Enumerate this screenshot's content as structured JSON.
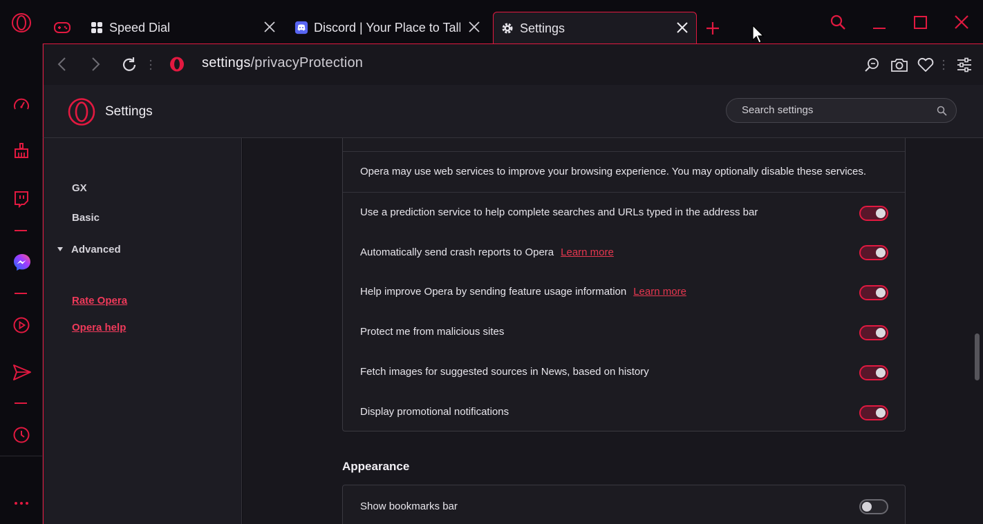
{
  "browser": {
    "tabs": [
      {
        "label": "Speed Dial",
        "icon": "speed-dial-grid-icon"
      },
      {
        "label": "Discord | Your Place to Talk",
        "icon": "discord-icon"
      },
      {
        "label": "Settings",
        "icon": "gear-icon",
        "active": true
      }
    ],
    "address": {
      "host": "settings",
      "path": "/privacyProtection"
    },
    "accent": "#e21940"
  },
  "settings": {
    "title": "Settings",
    "search_placeholder": "Search settings",
    "nav": {
      "gx": "GX",
      "basic": "Basic",
      "advanced": "Advanced",
      "rate": "Rate Opera",
      "help": "Opera help"
    },
    "privacy": {
      "intro": "Opera may use web services to improve your browsing experience. You may optionally disable these services.",
      "rows": [
        {
          "label": "Use a prediction service to help complete searches and URLs typed in the address bar",
          "on": true
        },
        {
          "label": "Automatically send crash reports to Opera",
          "link": "Learn more",
          "on": true
        },
        {
          "label": "Help improve Opera by sending feature usage information",
          "link": "Learn more",
          "on": true
        },
        {
          "label": "Protect me from malicious sites",
          "on": true
        },
        {
          "label": "Fetch images for suggested sources in News, based on history",
          "on": true
        },
        {
          "label": "Display promotional notifications",
          "on": true
        }
      ]
    },
    "appearance": {
      "title": "Appearance",
      "rows": [
        {
          "label": "Show bookmarks bar",
          "on": false
        }
      ]
    }
  }
}
